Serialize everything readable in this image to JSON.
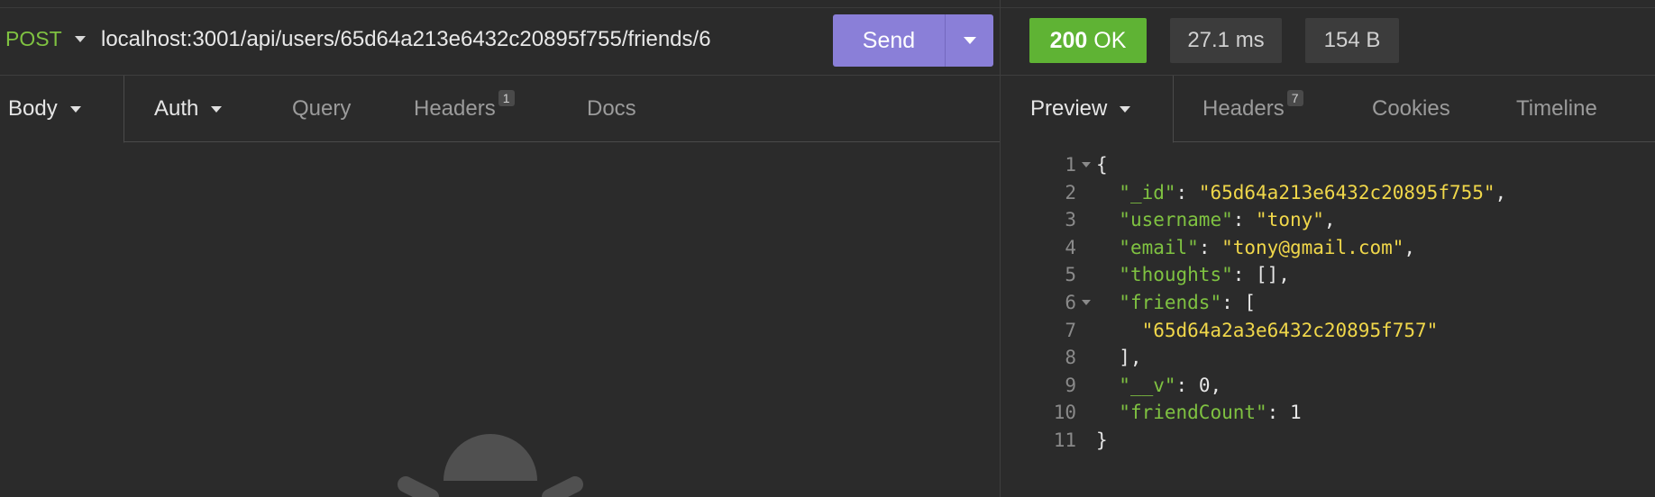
{
  "request": {
    "method": "POST",
    "url": "localhost:3001/api/users/65d64a213e6432c20895f755/friends/6",
    "send_label": "Send"
  },
  "request_tabs": [
    {
      "label": "Body",
      "dropdown": true,
      "active": true
    },
    {
      "label": "Auth",
      "dropdown": true
    },
    {
      "label": "Query"
    },
    {
      "label": "Headers",
      "badge": "1"
    },
    {
      "label": "Docs"
    }
  ],
  "response": {
    "status_code": "200",
    "status_text": "OK",
    "time": "27.1 ms",
    "size": "154 B",
    "status_color": "#5fb334",
    "accent_color": "#8a7fd8"
  },
  "response_tabs": [
    {
      "label": "Preview",
      "dropdown": true,
      "active": true
    },
    {
      "label": "Headers",
      "badge": "7"
    },
    {
      "label": "Cookies"
    },
    {
      "label": "Timeline"
    }
  ],
  "code_lines": [
    {
      "n": "1",
      "fold": true,
      "tokens": [
        {
          "t": "p",
          "v": "{"
        }
      ]
    },
    {
      "n": "2",
      "tokens": [
        {
          "t": "p",
          "v": "  "
        },
        {
          "t": "k",
          "v": "\"_id\""
        },
        {
          "t": "p",
          "v": ": "
        },
        {
          "t": "s",
          "v": "\"65d64a213e6432c20895f755\""
        },
        {
          "t": "p",
          "v": ","
        }
      ]
    },
    {
      "n": "3",
      "tokens": [
        {
          "t": "p",
          "v": "  "
        },
        {
          "t": "k",
          "v": "\"username\""
        },
        {
          "t": "p",
          "v": ": "
        },
        {
          "t": "s",
          "v": "\"tony\""
        },
        {
          "t": "p",
          "v": ","
        }
      ]
    },
    {
      "n": "4",
      "tokens": [
        {
          "t": "p",
          "v": "  "
        },
        {
          "t": "k",
          "v": "\"email\""
        },
        {
          "t": "p",
          "v": ": "
        },
        {
          "t": "s",
          "v": "\"tony@gmail.com\""
        },
        {
          "t": "p",
          "v": ","
        }
      ]
    },
    {
      "n": "5",
      "tokens": [
        {
          "t": "p",
          "v": "  "
        },
        {
          "t": "k",
          "v": "\"thoughts\""
        },
        {
          "t": "p",
          "v": ": [],"
        }
      ]
    },
    {
      "n": "6",
      "fold": true,
      "tokens": [
        {
          "t": "p",
          "v": "  "
        },
        {
          "t": "k",
          "v": "\"friends\""
        },
        {
          "t": "p",
          "v": ": ["
        }
      ]
    },
    {
      "n": "7",
      "tokens": [
        {
          "t": "p",
          "v": "    "
        },
        {
          "t": "s",
          "v": "\"65d64a2a3e6432c20895f757\""
        }
      ]
    },
    {
      "n": "8",
      "tokens": [
        {
          "t": "p",
          "v": "  ],"
        }
      ]
    },
    {
      "n": "9",
      "tokens": [
        {
          "t": "p",
          "v": "  "
        },
        {
          "t": "k",
          "v": "\"__v\""
        },
        {
          "t": "p",
          "v": ": "
        },
        {
          "t": "n",
          "v": "0"
        },
        {
          "t": "p",
          "v": ","
        }
      ]
    },
    {
      "n": "10",
      "tokens": [
        {
          "t": "p",
          "v": "  "
        },
        {
          "t": "k",
          "v": "\"friendCount\""
        },
        {
          "t": "p",
          "v": ": "
        },
        {
          "t": "n",
          "v": "1"
        }
      ]
    },
    {
      "n": "11",
      "tokens": [
        {
          "t": "p",
          "v": "}"
        }
      ]
    }
  ]
}
